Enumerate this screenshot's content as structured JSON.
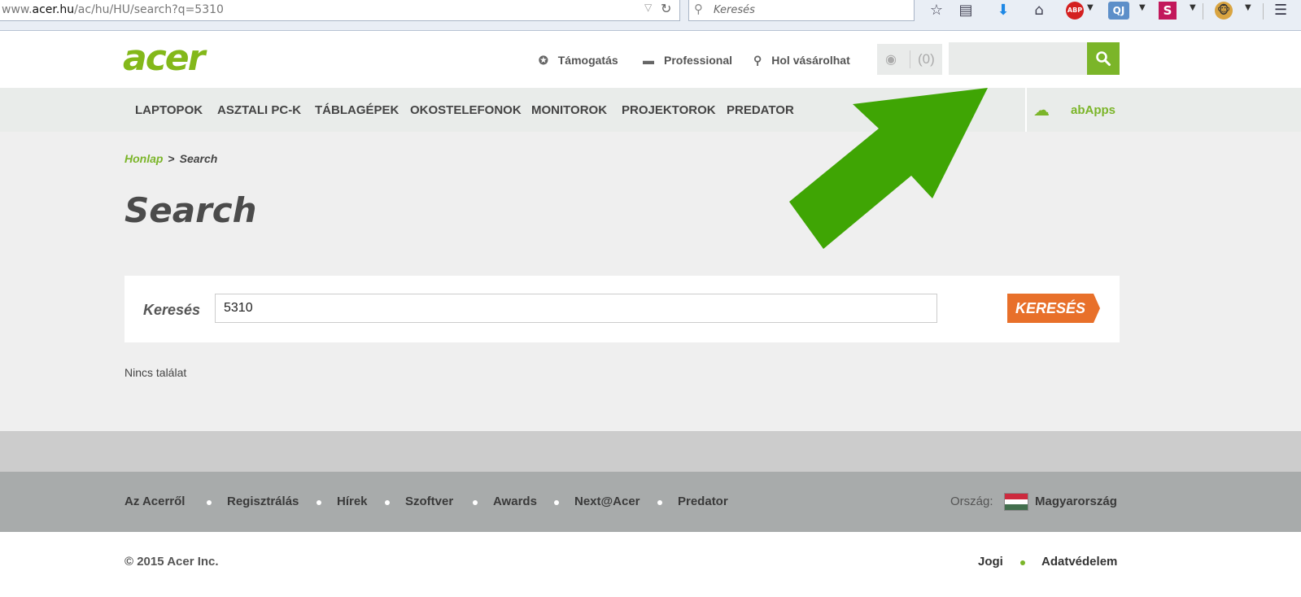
{
  "browser": {
    "url_prefix": "www.",
    "url_domain": "acer.hu",
    "url_path": "/ac/hu/HU/search?q=5310",
    "search_placeholder": "Keresés",
    "abp_label": "ABP",
    "qj_label": "QJ",
    "s_label": "S"
  },
  "header": {
    "logo_text": "acer",
    "links": [
      {
        "label": "Támogatás",
        "icon": "lifebuoy-icon"
      },
      {
        "label": "Professional",
        "icon": "briefcase-icon"
      },
      {
        "label": "Hol vásárolhat",
        "icon": "map-pin-icon"
      }
    ],
    "compare_count": "(0)",
    "search_value": ""
  },
  "nav": {
    "items": [
      "LAPTOPOK",
      "ASZTALI PC-K",
      "TÁBLAGÉPEK",
      "OKOSTELEFONOK",
      "MONITOROK",
      "PROJEKTOROK",
      "PREDATOR"
    ],
    "apps_label": "abApps"
  },
  "breadcrumb": {
    "home": "Honlap",
    "separator": ">",
    "current": "Search"
  },
  "page": {
    "title": "Search",
    "search_label": "Keresés",
    "search_value": "5310",
    "search_button": "KERESÉS",
    "no_results": "Nincs találat"
  },
  "footer": {
    "links": [
      "Az Acerről",
      "Regisztrálás",
      "Hírek",
      "Szoftver",
      "Awards",
      "Next@Acer",
      "Predator"
    ],
    "country_label": "Ország:",
    "country": "Magyarország",
    "copyright": "© 2015 Acer Inc.",
    "legal": [
      "Jogi",
      "Adatvédelem"
    ]
  },
  "colors": {
    "brand_green": "#83b81a",
    "accent_green": "#7bb529",
    "arrow_green": "#3fa504",
    "button_orange": "#e8702a"
  }
}
